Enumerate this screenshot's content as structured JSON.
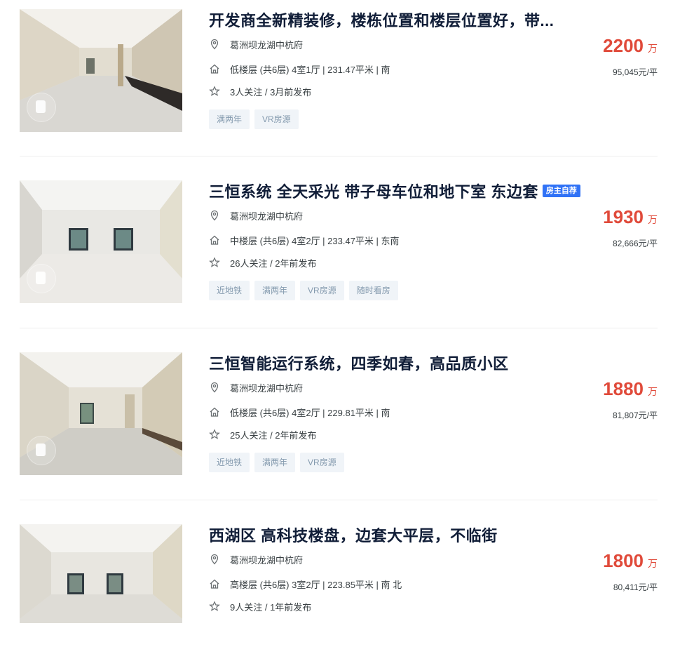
{
  "listings": [
    {
      "title": "开发商全新精装修，楼栋位置和楼层位置好，带...",
      "badge": "",
      "community": "葛洲坝龙湖中杭府",
      "house_info": "低楼层 (共6层) 4室1厅 | 231.47平米 | 南",
      "follow_info": "3人关注 / 3月前发布",
      "tags": [
        "满两年",
        "VR房源"
      ],
      "total_price": "2200",
      "total_unit": "万",
      "unit_price": "95,045元/平"
    },
    {
      "title": "三恒系统 全天采光 带子母车位和地下室 东边套",
      "badge": "房主自荐",
      "community": "葛洲坝龙湖中杭府",
      "house_info": "中楼层 (共6层) 4室2厅 | 233.47平米 | 东南",
      "follow_info": "26人关注 / 2年前发布",
      "tags": [
        "近地铁",
        "满两年",
        "VR房源",
        "随时看房"
      ],
      "total_price": "1930",
      "total_unit": "万",
      "unit_price": "82,666元/平"
    },
    {
      "title": "三恒智能运行系统，四季如春，高品质小区",
      "badge": "",
      "community": "葛洲坝龙湖中杭府",
      "house_info": "低楼层 (共6层) 4室2厅 | 229.81平米 | 南",
      "follow_info": "25人关注 / 2年前发布",
      "tags": [
        "近地铁",
        "满两年",
        "VR房源"
      ],
      "total_price": "1880",
      "total_unit": "万",
      "unit_price": "81,807元/平"
    },
    {
      "title": "西湖区 高科技楼盘，边套大平层，不临街",
      "badge": "",
      "community": "葛洲坝龙湖中杭府",
      "house_info": "高楼层 (共6层) 3室2厅 | 223.85平米 | 南 北",
      "follow_info": "9人关注 / 1年前发布",
      "tags": [],
      "total_price": "1800",
      "total_unit": "万",
      "unit_price": "80,411元/平"
    }
  ],
  "colors": {
    "title": "#101d37",
    "price": "#e04a3a",
    "badge": "#3072f6",
    "tag_bg": "#f0f4f8",
    "tag_text": "#849aae"
  },
  "icons": {
    "community": "location-pin-icon",
    "house": "house-icon",
    "follow": "star-icon",
    "photo_badge": "vr-icon"
  }
}
